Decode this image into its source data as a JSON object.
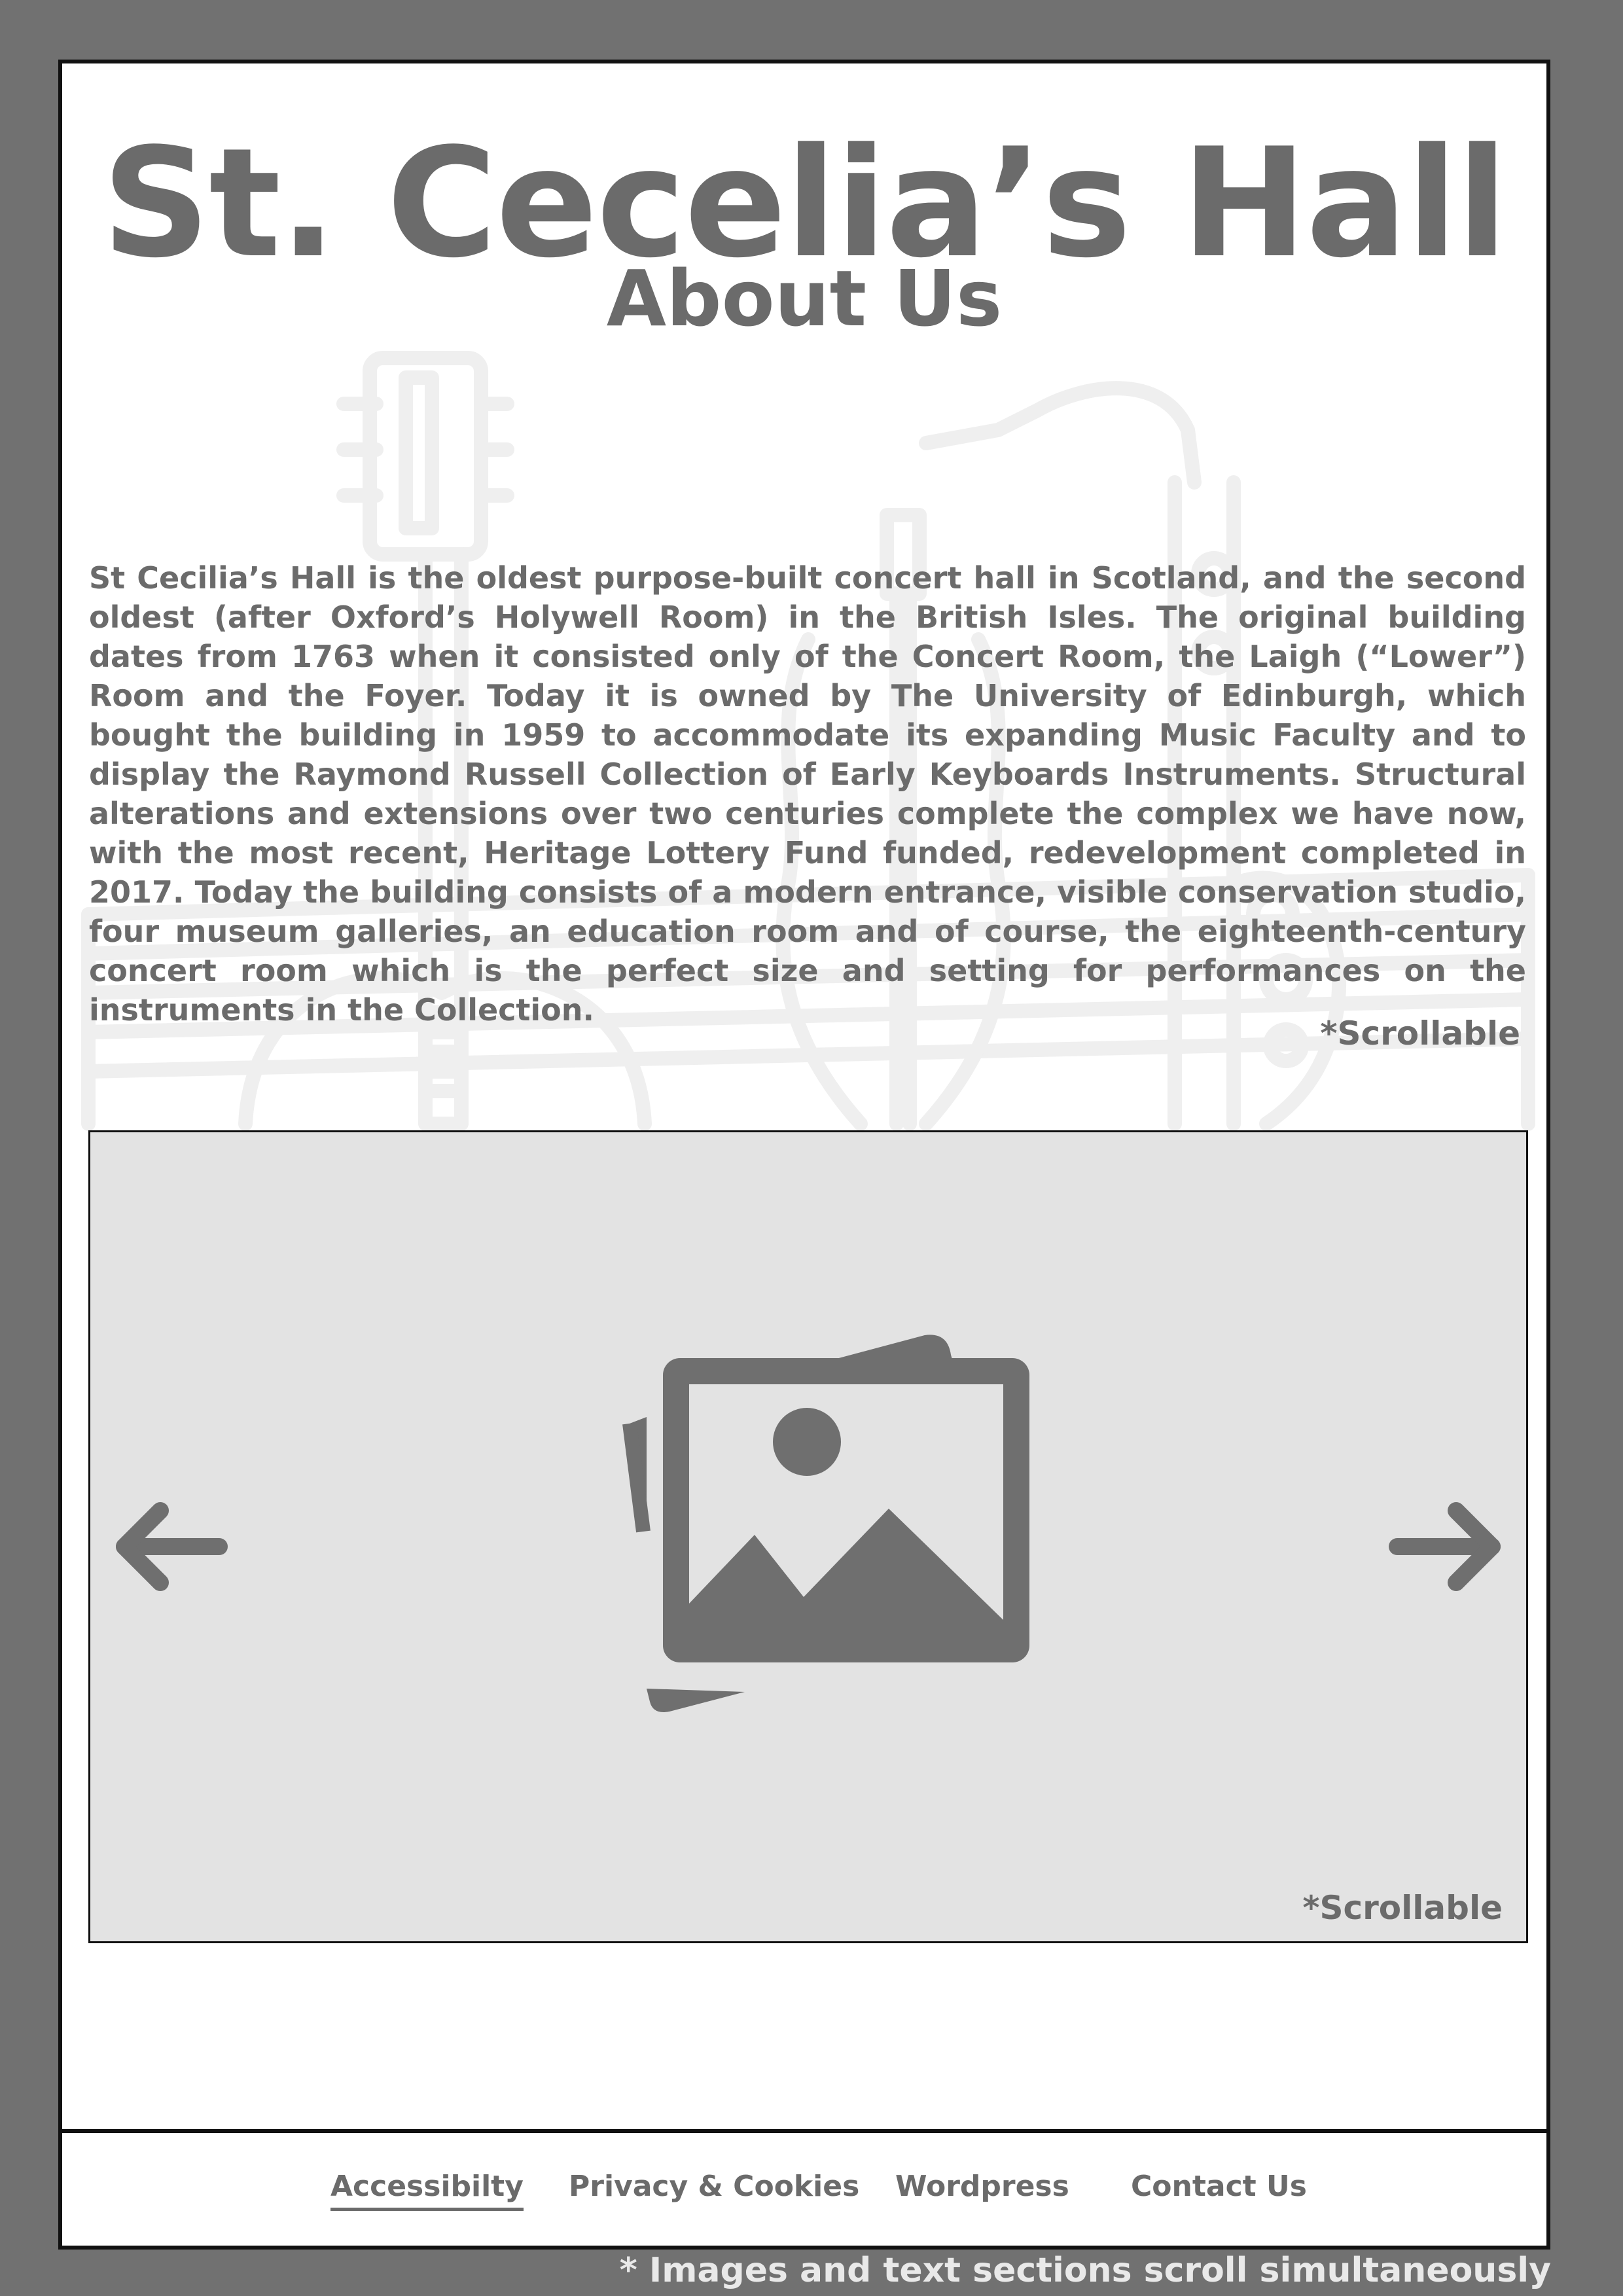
{
  "header": {
    "title": "St. Cecelia’s Hall",
    "subtitle": "About Us"
  },
  "about": {
    "body": "St Cecilia’s Hall is the oldest purpose-built concert hall in Scotland, and the second oldest (after Oxford’s Holywell Room) in the British Isles. The original building dates from 1763 when it consisted only of the Concert Room, the Laigh (“Lower”) Room and the Foyer. Today it is owned by The University of Edinburgh, which bought the building in 1959 to accommodate its expanding Music Faculty and to display the Raymond Russell Collection of Early Keyboards Instruments. Structural alterations and extensions over two centuries complete the complex we have now, with the most recent, Heritage Lottery Fund funded, redevelopment completed in 2017. Today the building consists of a modern entrance, visible conservation studio, four museum galleries, an education room and of course, the eighteenth-century concert room which is the perfect size and setting for performances on the instruments in the Collection.",
    "scroll_note": "*Scrollable"
  },
  "carousel": {
    "scroll_note": "*Scrollable",
    "prev_icon": "arrow-left-icon",
    "next_icon": "arrow-right-icon",
    "image_icon": "image-placeholder-icon"
  },
  "footer": {
    "links": [
      {
        "label": "Accessibilty",
        "active": true
      },
      {
        "label": "Privacy & Cookies",
        "active": false
      },
      {
        "label": "Wordpress",
        "active": false
      },
      {
        "label": "Contact Us",
        "active": false
      }
    ]
  },
  "global_note": "* Images and text sections scroll simultaneously",
  "colors": {
    "background": "#717171",
    "text": "#6b6b6b",
    "panel": "#e3e3e3",
    "border": "#111111"
  }
}
